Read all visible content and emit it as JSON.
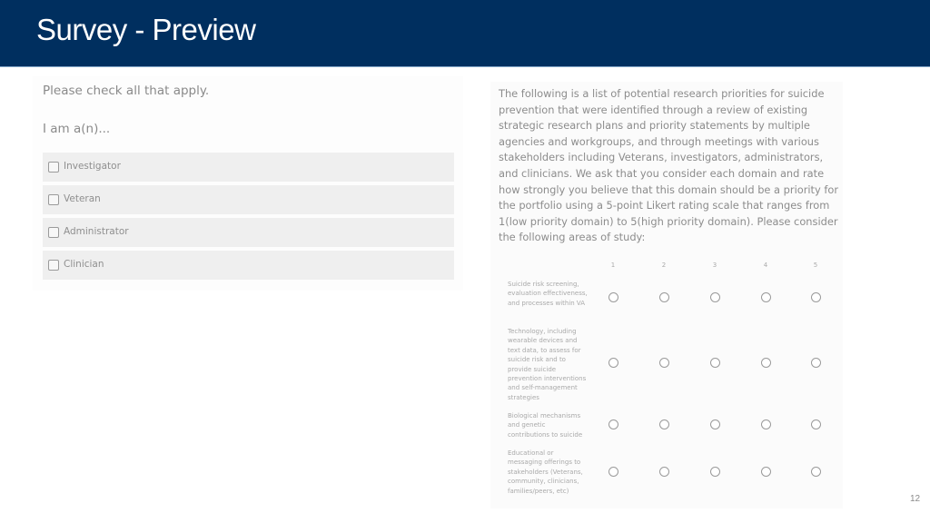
{
  "header": {
    "title": "Survey - Preview"
  },
  "left_question": {
    "prompt": "Please check all that apply.",
    "question": "I am a(n)...",
    "options": [
      {
        "label": "Investigator",
        "checked": false
      },
      {
        "label": "Veteran",
        "checked": false
      },
      {
        "label": "Administrator",
        "checked": false
      },
      {
        "label": "Clinician",
        "checked": false
      }
    ]
  },
  "right_question": {
    "intro": "The following is a list of potential research priorities for suicide prevention that were identified through a review of existing strategic research plans and priority statements by multiple agencies and workgroups, and through meetings with various stakeholders including Veterans, investigators, administrators, and clinicians. We ask that you consider each domain and rate how strongly you believe that this domain should be a priority for the portfolio using a 5-point Likert rating scale that ranges from 1(low priority domain) to 5(high priority domain). Please consider the following areas of study:",
    "scale": [
      "1",
      "2",
      "3",
      "4",
      "5"
    ],
    "rows": [
      {
        "label": "Suicide risk screening, evaluation effectiveness, and processes within VA",
        "selected": null
      },
      {
        "label": "Technology, including wearable devices and text data, to assess for suicide risk and to provide suicide prevention interventions and self-management strategies",
        "selected": null
      },
      {
        "label": "Biological mechanisms and genetic contributions to suicide",
        "selected": null
      },
      {
        "label": "Educational or messaging offerings to stakeholders (Veterans, community, clinicians, families/peers, etc)",
        "selected": null
      }
    ]
  },
  "footer": {
    "page_number": "12"
  }
}
